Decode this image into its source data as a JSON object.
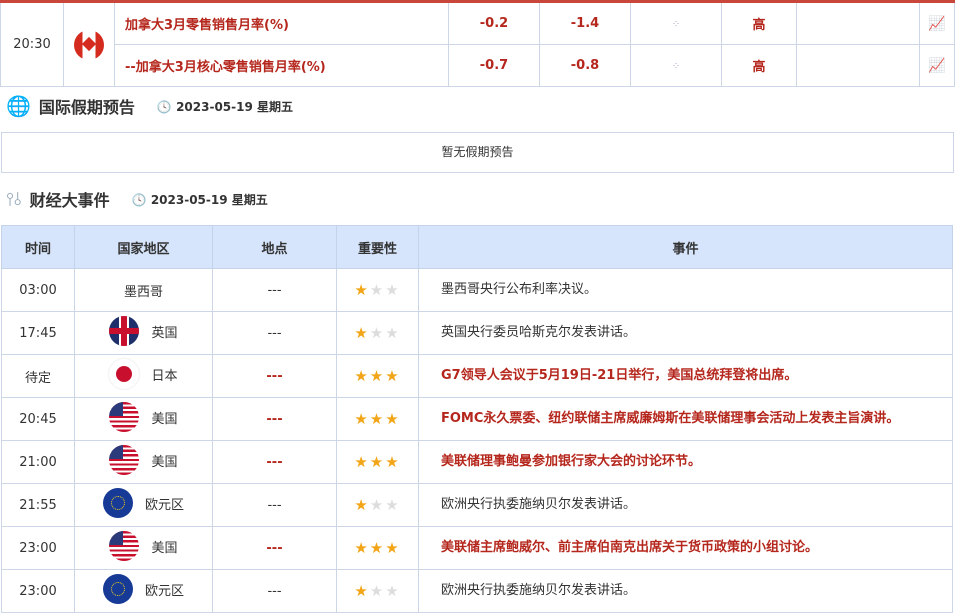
{
  "indicators": {
    "time": "20:30",
    "rows": [
      {
        "name": "加拿大3月零售销售月率(%)",
        "previous": "-0.2",
        "forecast": "-1.4",
        "importance": "高"
      },
      {
        "name": "--加拿大3月核心零售销售月率(%)",
        "previous": "-0.7",
        "forecast": "-0.8",
        "importance": "高"
      }
    ]
  },
  "holidays": {
    "title": "国际假期预告",
    "date": "2023-05-19 星期五",
    "empty": "暂无假期预告"
  },
  "events": {
    "title": "财经大事件",
    "date": "2023-05-19 星期五",
    "headers": [
      "时间",
      "国家地区",
      "地点",
      "重要性",
      "事件"
    ],
    "rows": [
      {
        "time": "03:00",
        "country": "墨西哥",
        "flag": "",
        "place": "---",
        "stars": 1,
        "event": "墨西哥央行公布利率决议。"
      },
      {
        "time": "17:45",
        "country": "英国",
        "flag": "uk",
        "place": "---",
        "stars": 1,
        "event": "英国央行委员哈斯克尔发表讲话。"
      },
      {
        "time": "待定",
        "country": "日本",
        "flag": "jp",
        "place": "---",
        "stars": 3,
        "event": "G7领导人会议于5月19日-21日举行，美国总统拜登将出席。"
      },
      {
        "time": "20:45",
        "country": "美国",
        "flag": "us",
        "place": "---",
        "stars": 3,
        "event": "FOMC永久票委、纽约联储主席威廉姆斯在美联储理事会活动上发表主旨演讲。"
      },
      {
        "time": "21:00",
        "country": "美国",
        "flag": "us",
        "place": "---",
        "stars": 3,
        "event": "美联储理事鲍曼参加银行家大会的讨论环节。"
      },
      {
        "time": "21:55",
        "country": "欧元区",
        "flag": "eu",
        "place": "---",
        "stars": 1,
        "event": "欧洲央行执委施纳贝尔发表讲话。"
      },
      {
        "time": "23:00",
        "country": "美国",
        "flag": "us",
        "place": "---",
        "stars": 3,
        "event": "美联储主席鲍威尔、前主席伯南克出席关于货币政策的小组讨论。"
      },
      {
        "time": "23:00",
        "country": "欧元区",
        "flag": "eu",
        "place": "---",
        "stars": 1,
        "event": "欧洲央行执委施纳贝尔发表讲话。"
      }
    ]
  }
}
